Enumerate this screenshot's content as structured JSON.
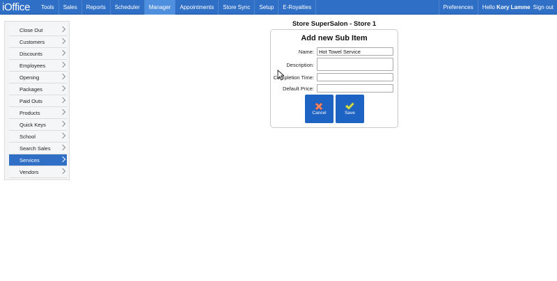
{
  "app": {
    "logo": "iOffice"
  },
  "nav": {
    "items": [
      {
        "label": "Tools"
      },
      {
        "label": "Sales"
      },
      {
        "label": "Reports"
      },
      {
        "label": "Scheduler"
      },
      {
        "label": "Manager",
        "active": true
      },
      {
        "label": "Appointments"
      },
      {
        "label": "Store Sync"
      },
      {
        "label": "Setup"
      },
      {
        "label": "E-Royalties"
      }
    ],
    "preferences": "Preferences",
    "hello": "Hello",
    "user": "Kory Lamme",
    "sign_out": "Sign out"
  },
  "sidebar": {
    "items": [
      {
        "label": "Close Out"
      },
      {
        "label": "Customers"
      },
      {
        "label": "Discounts"
      },
      {
        "label": "Employees"
      },
      {
        "label": "Opening"
      },
      {
        "label": "Packages"
      },
      {
        "label": "Paid Outs"
      },
      {
        "label": "Products"
      },
      {
        "label": "Quick Keys"
      },
      {
        "label": "School"
      },
      {
        "label": "Search Sales"
      },
      {
        "label": "Services",
        "active": true
      },
      {
        "label": "Vendors"
      }
    ]
  },
  "main": {
    "store_title": "Store SuperSalon - Store 1",
    "form": {
      "title": "Add new Sub Item",
      "name_label": "Name:",
      "name_value": "Hot Towel Service",
      "description_label": "Description:",
      "description_value": "",
      "completion_label": "Completion Time:",
      "completion_value": "",
      "price_label": "Default Price:",
      "price_value": "",
      "cancel_label": "Cancel",
      "save_label": "Save"
    }
  },
  "colors": {
    "nav_bg": "#2f6fc6",
    "nav_active": "#4f8fe0",
    "button_bg": "#1d63c4",
    "cancel_icon": "#f08a6a",
    "save_icon": "#d7e35a"
  },
  "icons": {
    "cancel": "x-icon",
    "save": "checkmark-icon"
  }
}
